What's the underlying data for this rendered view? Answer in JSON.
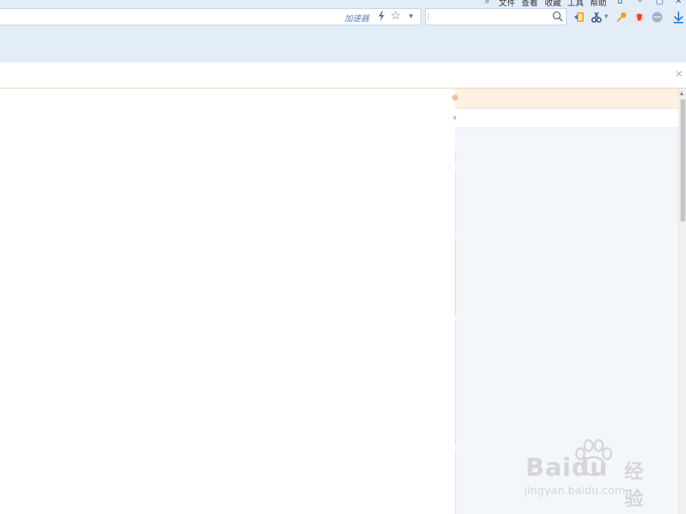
{
  "menu": {
    "more": "»",
    "items": [
      "文件",
      "查看",
      "收藏",
      "工具",
      "帮助"
    ],
    "window_controls": [
      "⌂",
      "–",
      "▢",
      "✕"
    ]
  },
  "address_bar": {
    "accelerator_label": "加速器"
  },
  "search": {
    "placeholder": ""
  },
  "toolbar_icons": [
    "back-to-tab-icon",
    "scissors-icon",
    "key-icon",
    "red-app-icon",
    "chat-bubble-icon",
    "download-icon"
  ],
  "notification": {
    "close_label": "×"
  },
  "watermark": {
    "brand": "Baidu",
    "brand_suffix": "经验",
    "url": "jingyan.baidu.com"
  },
  "bottom_text": "……………………"
}
